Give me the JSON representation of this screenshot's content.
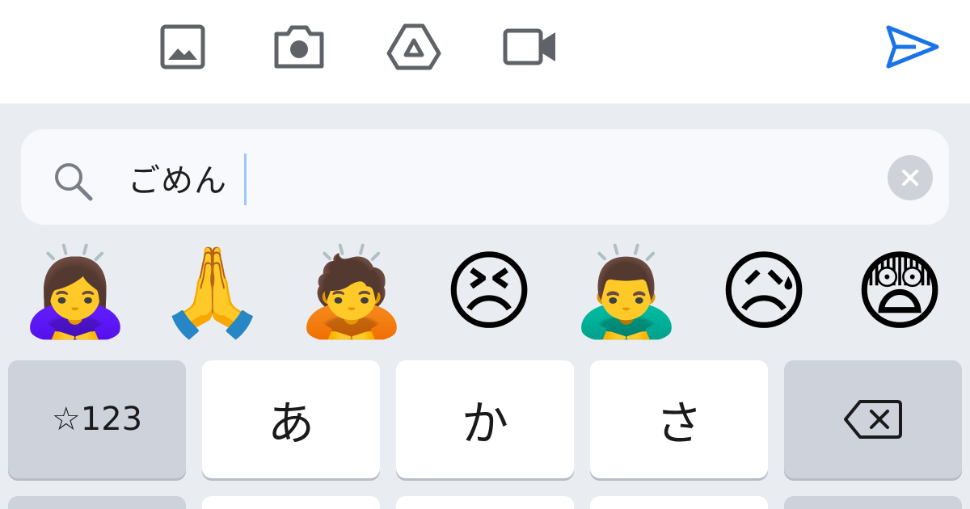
{
  "toolbar": {
    "icons": [
      "image-icon",
      "camera-icon",
      "drive-icon",
      "video-icon",
      "send-icon"
    ],
    "send_color": "#1a73e8",
    "icon_color": "#5f6368"
  },
  "search": {
    "value": "ごめん",
    "icon": "search-icon",
    "clear_icon": "clear-icon"
  },
  "emoji_suggestions": [
    "🙇‍♀️",
    "🙏",
    "🙇",
    "😣",
    "🙇‍♂️",
    "😥",
    "😨"
  ],
  "keyboard": {
    "row1": [
      {
        "label": "☆123",
        "style": "gray"
      },
      {
        "label": "あ",
        "style": "white"
      },
      {
        "label": "か",
        "style": "white"
      },
      {
        "label": "さ",
        "style": "white"
      },
      {
        "label": "",
        "icon": "backspace-icon",
        "style": "gray"
      }
    ]
  }
}
